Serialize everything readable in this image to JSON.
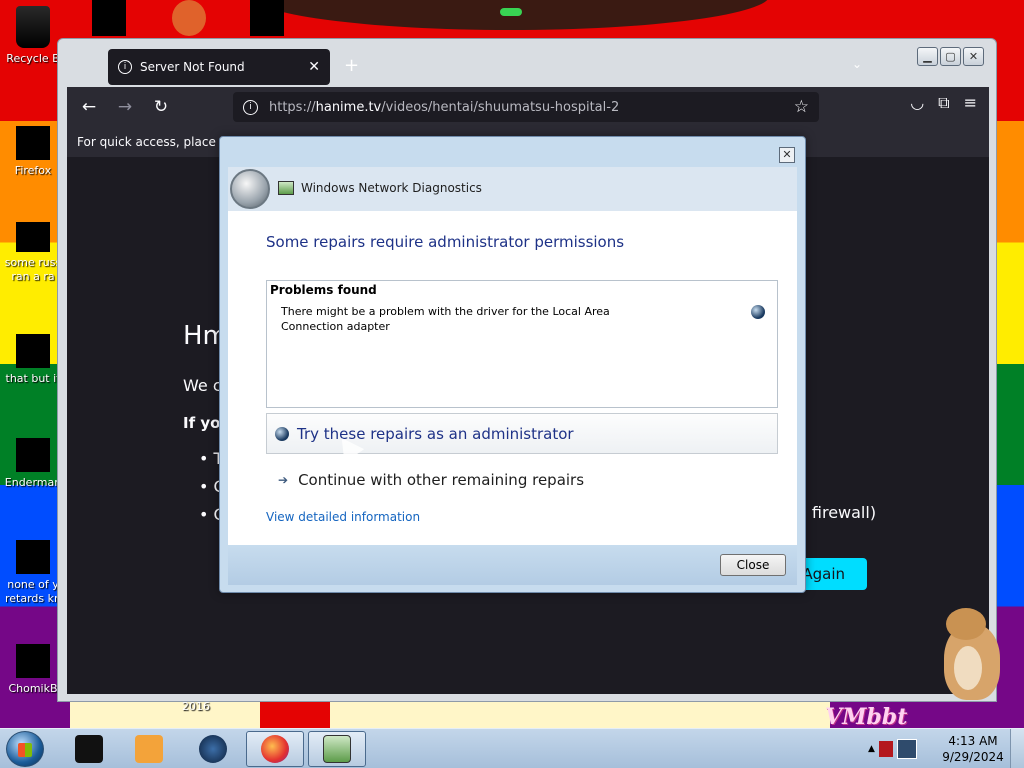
{
  "desktop": {
    "icons": [
      {
        "label": "Recycle B",
        "top": 0
      },
      {
        "label": "Firefox",
        "top": 0
      },
      {
        "label": "some russ ran a ra",
        "top": 0
      },
      {
        "label": "that but it",
        "top": 0
      },
      {
        "label": "Enderman",
        "top": 0
      },
      {
        "label": "none of y retards kn",
        "top": 0
      },
      {
        "label": "ChomikB",
        "top": 0
      }
    ],
    "bottom_label": "2016",
    "watermark": "VMbbt"
  },
  "browser": {
    "tab_title": "Server Not Found",
    "new_tab": "+",
    "url_scheme": "https://",
    "url_host": "hanime.tv",
    "url_path": "/videos/hentai/shuumatsu-hospital-2",
    "bookmarks_hint": "For quick access, place you",
    "error": {
      "title": "Hm",
      "line1": "We c",
      "line2": "If you",
      "bullets": [
        "T",
        "C",
        "C"
      ],
      "firewall_tail": "a firewall)",
      "try_again": "Again"
    }
  },
  "dialog": {
    "title": "Windows Network Diagnostics",
    "heading": "Some repairs require administrator permissions",
    "problems_title": "Problems found",
    "problem_text": "There might be a problem with the driver for the Local Area Connection adapter",
    "repair_admin": "Try these repairs as an administrator",
    "repair_other": "Continue with other remaining repairs",
    "view_details": "View detailed information",
    "close": "Close"
  },
  "taskbar": {
    "time": "4:13 AM",
    "date": "9/29/2024"
  }
}
